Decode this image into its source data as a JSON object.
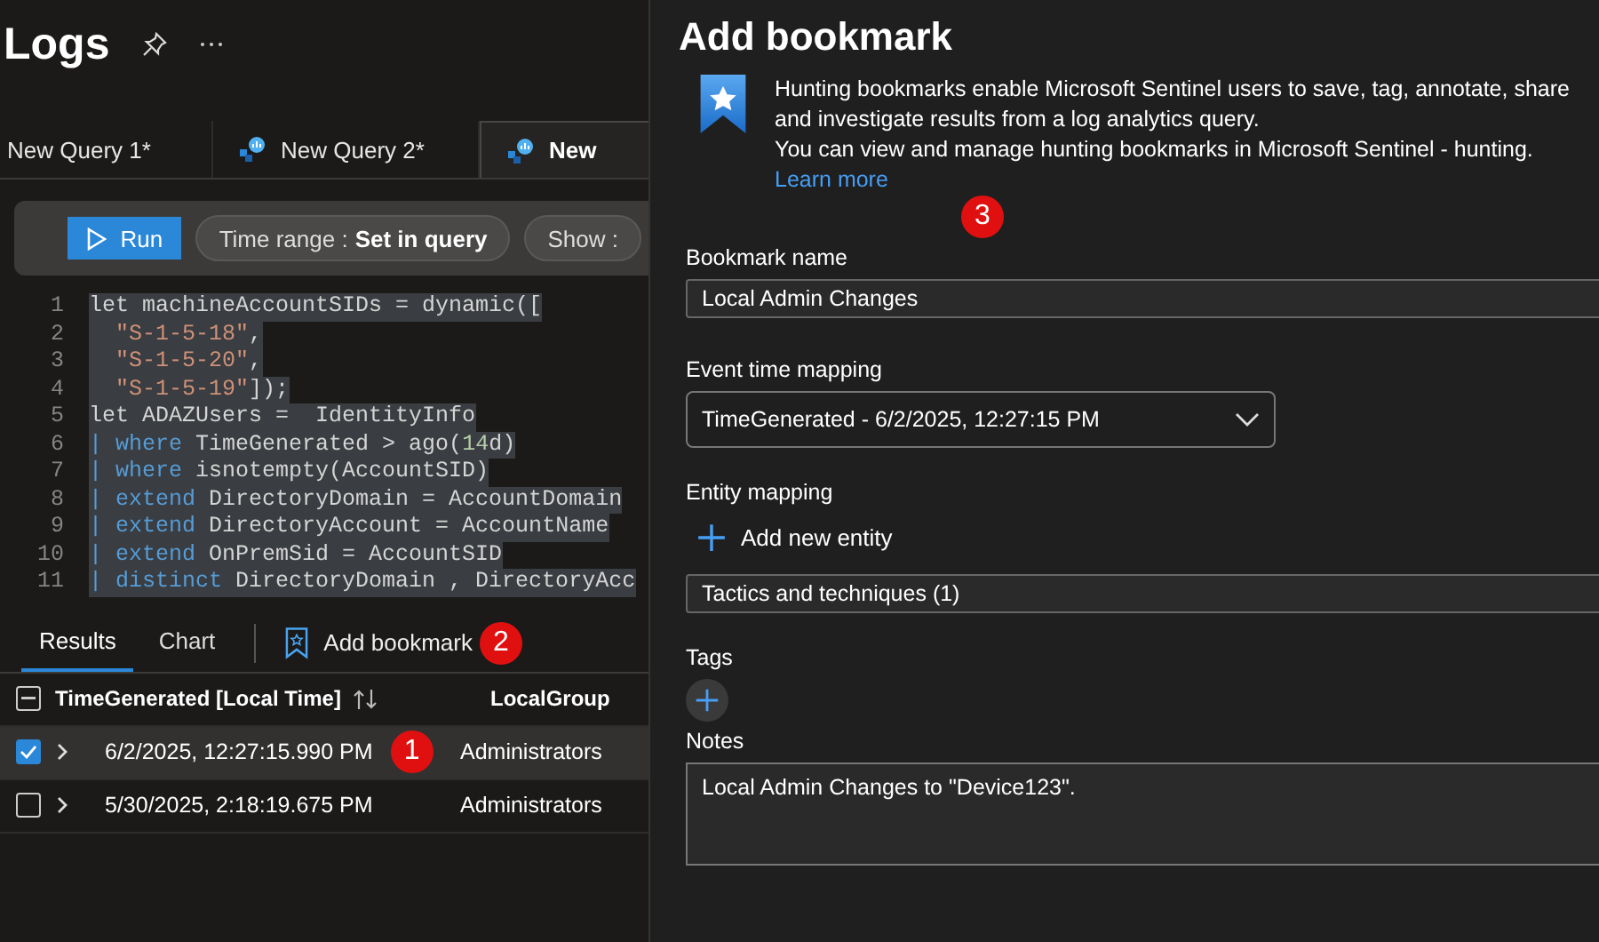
{
  "logs": {
    "title": "Logs",
    "query_tabs": [
      {
        "label": "New Query 1*",
        "selected": false
      },
      {
        "label": "New Query 2*",
        "selected": false
      },
      {
        "label": "New",
        "selected": true
      }
    ],
    "toolbar": {
      "run": "Run",
      "time_range_label": "Time range :",
      "time_range_value": "Set in query",
      "show_label": "Show :"
    },
    "code_lines": [
      {
        "number": "1",
        "tokens": [
          {
            "kind": "plain",
            "text": "let machineAccountSIDs = dynamic(["
          }
        ]
      },
      {
        "number": "2",
        "tokens": [
          {
            "kind": "string",
            "text": "  \"S-1-5-18\""
          },
          {
            "kind": "plain",
            "text": ","
          }
        ]
      },
      {
        "number": "3",
        "tokens": [
          {
            "kind": "string",
            "text": "  \"S-1-5-20\""
          },
          {
            "kind": "plain",
            "text": ","
          }
        ]
      },
      {
        "number": "4",
        "tokens": [
          {
            "kind": "string",
            "text": "  \"S-1-5-19\""
          },
          {
            "kind": "plain",
            "text": "]);"
          }
        ]
      },
      {
        "number": "5",
        "tokens": [
          {
            "kind": "plain",
            "text": "let ADAZUsers =  IdentityInfo"
          }
        ]
      },
      {
        "number": "6",
        "tokens": [
          {
            "kind": "pipe",
            "text": "| "
          },
          {
            "kind": "keyword",
            "text": "where"
          },
          {
            "kind": "plain",
            "text": " TimeGenerated > ago("
          },
          {
            "kind": "number",
            "text": "14"
          },
          {
            "kind": "plain",
            "text": "d)"
          }
        ]
      },
      {
        "number": "7",
        "tokens": [
          {
            "kind": "pipe",
            "text": "| "
          },
          {
            "kind": "keyword",
            "text": "where"
          },
          {
            "kind": "plain",
            "text": " isnotempty(AccountSID)"
          }
        ]
      },
      {
        "number": "8",
        "tokens": [
          {
            "kind": "pipe",
            "text": "| "
          },
          {
            "kind": "keyword",
            "text": "extend"
          },
          {
            "kind": "plain",
            "text": " DirectoryDomain = AccountDomain"
          }
        ]
      },
      {
        "number": "9",
        "tokens": [
          {
            "kind": "pipe",
            "text": "| "
          },
          {
            "kind": "keyword",
            "text": "extend"
          },
          {
            "kind": "plain",
            "text": " DirectoryAccount = AccountName"
          }
        ]
      },
      {
        "number": "10",
        "tokens": [
          {
            "kind": "pipe",
            "text": "| "
          },
          {
            "kind": "keyword",
            "text": "extend"
          },
          {
            "kind": "plain",
            "text": " OnPremSid = AccountSID"
          }
        ]
      },
      {
        "number": "11",
        "tokens": [
          {
            "kind": "pipe",
            "text": "| "
          },
          {
            "kind": "keyword",
            "text": "distinct"
          },
          {
            "kind": "plain",
            "text": " DirectoryDomain , DirectoryAcc"
          }
        ]
      }
    ],
    "result_tabs": [
      {
        "label": "Results",
        "selected": true
      },
      {
        "label": "Chart",
        "selected": false
      }
    ],
    "add_bookmark": "Add bookmark",
    "add_bookmark_badge": "2",
    "table": {
      "header_checkbox_partial": true,
      "columns": [
        "TimeGenerated [Local Time]",
        "LocalGroup"
      ],
      "rows": [
        {
          "checked": true,
          "selected": true,
          "time": "6/2/2025, 12:27:15.990 PM",
          "group": "Administrators",
          "badge": "1"
        },
        {
          "checked": false,
          "selected": false,
          "time": "5/30/2025, 2:18:19.675 PM",
          "group": "Administrators"
        }
      ]
    }
  },
  "panel": {
    "title": "Add bookmark",
    "info": [
      "Hunting bookmarks enable Microsoft Sentinel users to save, tag, annotate, share and investigate results from a log analytics query.",
      "You can view and manage hunting bookmarks in Microsoft Sentinel - hunting."
    ],
    "learn_more": "Learn more",
    "badge": "3",
    "bookmark_name": {
      "label": "Bookmark name",
      "value": "Local Admin Changes"
    },
    "event_time": {
      "label": "Event time mapping",
      "value": "TimeGenerated - 6/2/2025, 12:27:15 PM"
    },
    "entity_mapping": {
      "label": "Entity mapping",
      "add": "Add new entity"
    },
    "tactics": "Tactics and techniques (1)",
    "tags": {
      "label": "Tags"
    },
    "notes": {
      "label": "Notes",
      "value": "Local Admin Changes to \"Device123\"."
    }
  }
}
